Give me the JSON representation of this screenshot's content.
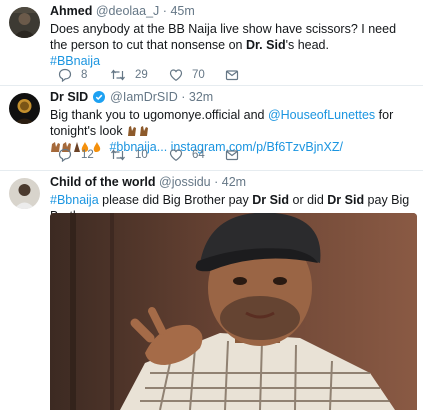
{
  "tweets": [
    {
      "name": "Ahmed",
      "handle": "@deolaa_J",
      "time": "45m",
      "text_a": "Does anybody at the BB Naija live show have scissors?  I need the person to cut that nonsense on ",
      "text_bold": "Dr. Sid",
      "text_b": "'s head.",
      "hashtag": "#BBnaija",
      "replies": "8",
      "retweets": "29",
      "likes": "70"
    },
    {
      "name": "Dr SID",
      "handle": "@IamDrSID",
      "time": "32m",
      "text_a": "Big thank you to ugomonye.official and ",
      "mention": "@HouseofLunettes",
      "text_b": " for tonight's look",
      "hashtag": "#bbnaija...",
      "url": "instagram.com/p/Bf6TzvBjnXZ/",
      "replies": "12",
      "retweets": "10",
      "likes": "64"
    },
    {
      "name": "Child of the world",
      "handle": "@jossidu",
      "time": "42m",
      "hashtag": "#Bbnaija",
      "text_a": " please did Big Brother pay ",
      "bold_1": "Dr Sid",
      "text_b": " or did ",
      "bold_2": "Dr Sid",
      "text_c": " pay Big Brother"
    }
  ],
  "separator": "·",
  "colors": {
    "link": "#1b95e0",
    "meta": "#657786",
    "verified": "#1da1f2"
  }
}
